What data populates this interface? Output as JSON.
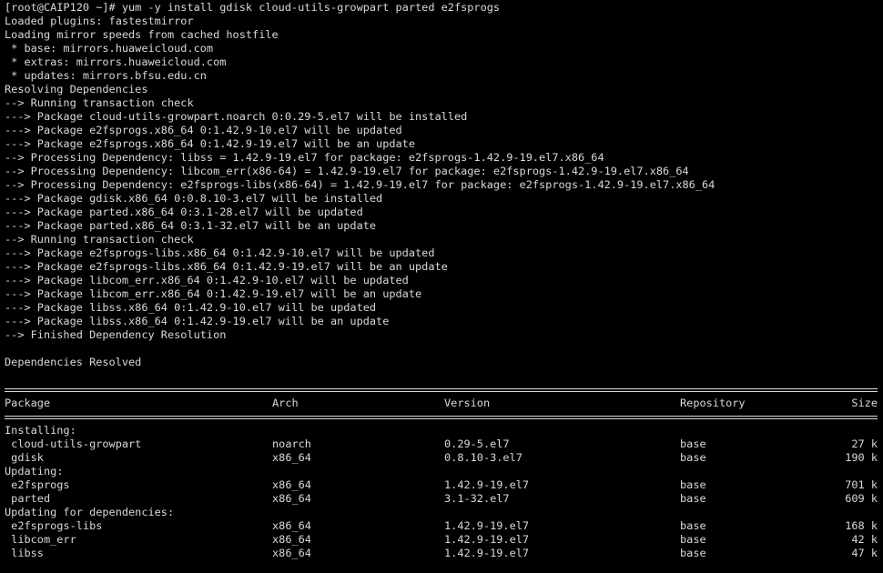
{
  "terminal": {
    "lines": [
      "[root@CAIP120 ~]# yum -y install gdisk cloud-utils-growpart parted e2fsprogs",
      "Loaded plugins: fastestmirror",
      "Loading mirror speeds from cached hostfile",
      " * base: mirrors.huaweicloud.com",
      " * extras: mirrors.huaweicloud.com",
      " * updates: mirrors.bfsu.edu.cn",
      "Resolving Dependencies",
      "--> Running transaction check",
      "---> Package cloud-utils-growpart.noarch 0:0.29-5.el7 will be installed",
      "---> Package e2fsprogs.x86_64 0:1.42.9-10.el7 will be updated",
      "---> Package e2fsprogs.x86_64 0:1.42.9-19.el7 will be an update",
      "--> Processing Dependency: libss = 1.42.9-19.el7 for package: e2fsprogs-1.42.9-19.el7.x86_64",
      "--> Processing Dependency: libcom_err(x86-64) = 1.42.9-19.el7 for package: e2fsprogs-1.42.9-19.el7.x86_64",
      "--> Processing Dependency: e2fsprogs-libs(x86-64) = 1.42.9-19.el7 for package: e2fsprogs-1.42.9-19.el7.x86_64",
      "---> Package gdisk.x86_64 0:0.8.10-3.el7 will be installed",
      "---> Package parted.x86_64 0:3.1-28.el7 will be updated",
      "---> Package parted.x86_64 0:3.1-32.el7 will be an update",
      "--> Running transaction check",
      "---> Package e2fsprogs-libs.x86_64 0:1.42.9-10.el7 will be updated",
      "---> Package e2fsprogs-libs.x86_64 0:1.42.9-19.el7 will be an update",
      "---> Package libcom_err.x86_64 0:1.42.9-10.el7 will be updated",
      "---> Package libcom_err.x86_64 0:1.42.9-19.el7 will be an update",
      "---> Package libss.x86_64 0:1.42.9-10.el7 will be updated",
      "---> Package libss.x86_64 0:1.42.9-19.el7 will be an update",
      "--> Finished Dependency Resolution",
      "",
      "Dependencies Resolved",
      ""
    ],
    "table": {
      "headers": {
        "package": "Package",
        "arch": "Arch",
        "version": "Version",
        "repository": "Repository",
        "size": "Size"
      },
      "rows": [
        {
          "section": "Installing:"
        },
        {
          "package": " cloud-utils-growpart",
          "arch": "noarch",
          "version": "0.29-5.el7",
          "repository": "base",
          "size": "27 k"
        },
        {
          "package": " gdisk",
          "arch": "x86_64",
          "version": "0.8.10-3.el7",
          "repository": "base",
          "size": "190 k"
        },
        {
          "section": "Updating:"
        },
        {
          "package": " e2fsprogs",
          "arch": "x86_64",
          "version": "1.42.9-19.el7",
          "repository": "base",
          "size": "701 k"
        },
        {
          "package": " parted",
          "arch": "x86_64",
          "version": "3.1-32.el7",
          "repository": "base",
          "size": "609 k"
        },
        {
          "section": "Updating for dependencies:"
        },
        {
          "package": " e2fsprogs-libs",
          "arch": "x86_64",
          "version": "1.42.9-19.el7",
          "repository": "base",
          "size": "168 k"
        },
        {
          "package": " libcom_err",
          "arch": "x86_64",
          "version": "1.42.9-19.el7",
          "repository": "base",
          "size": "42 k"
        },
        {
          "package": " libss",
          "arch": "x86_64",
          "version": "1.42.9-19.el7",
          "repository": "base",
          "size": "47 k"
        }
      ]
    }
  },
  "colors": {
    "background": "#000000",
    "foreground": "#d9d9d9"
  }
}
